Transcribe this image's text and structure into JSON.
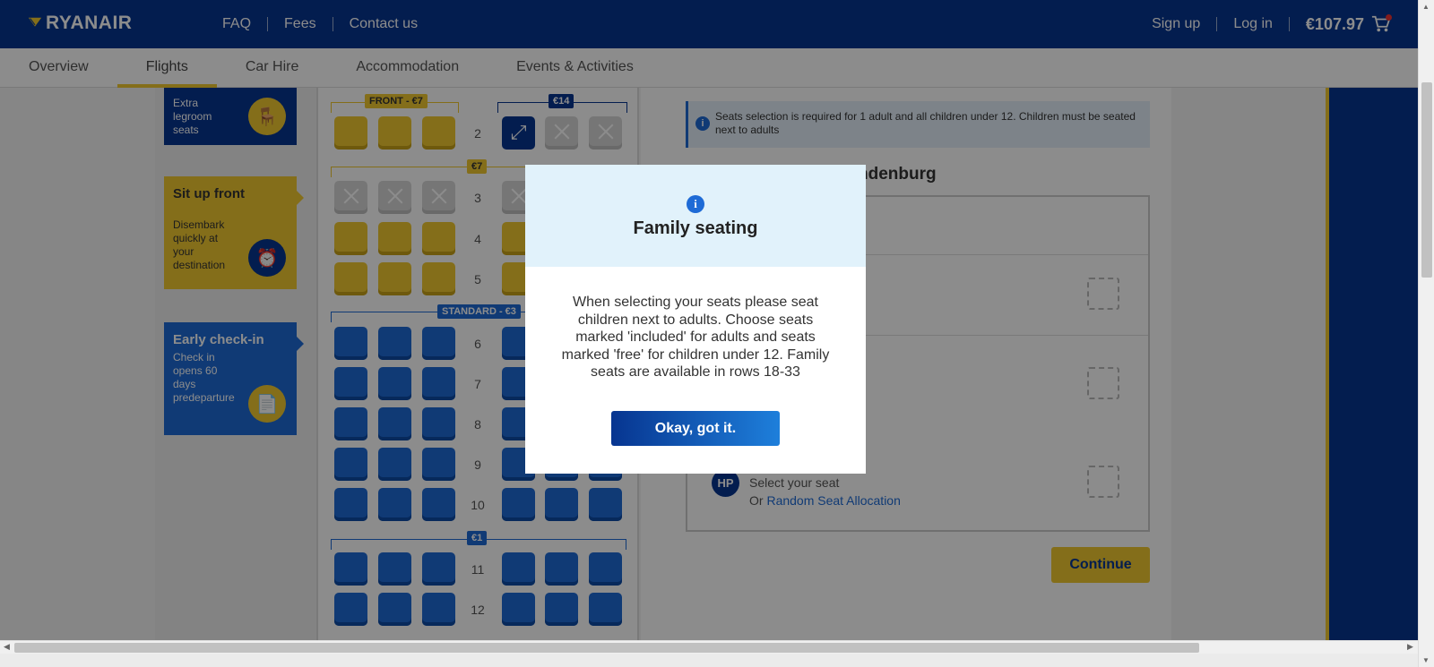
{
  "header": {
    "logo": "RYANAIR",
    "nav": [
      "FAQ",
      "Fees",
      "Contact us"
    ],
    "sign_up": "Sign up",
    "log_in": "Log in",
    "price": "€107.97"
  },
  "tabs": [
    "Overview",
    "Flights",
    "Car Hire",
    "Accommodation",
    "Events & Activities"
  ],
  "sidebar": {
    "extra_legroom": "Extra legroom seats",
    "sit_up_front": {
      "title": "Sit up front",
      "body": "Disembark quickly at your destination"
    },
    "early_checkin": {
      "title": "Early check-in",
      "body": "Check in opens 60 days predeparture"
    }
  },
  "seatmap": {
    "zones": {
      "front": "FRONT - €7",
      "extra": "€14",
      "mid": "€7",
      "standard": "STANDARD - €3",
      "cheap": "€1"
    },
    "rows": [
      "2",
      "3",
      "4",
      "5",
      "6",
      "7",
      "8",
      "9",
      "10",
      "11",
      "12"
    ]
  },
  "panel": {
    "info": "Seats selection is required for 1 adult and all children under 12. Children must be seated next to adults",
    "destination": "ndenburg",
    "initials": "HP",
    "select_seat": "Select your seat",
    "or": "Or",
    "random": "Random Seat Allocation",
    "continue": "Continue"
  },
  "modal": {
    "icon": "i",
    "title": "Family seating",
    "body": "When selecting your seats please seat children next to adults. Choose seats marked 'included' for adults and seats marked 'free' for children under 12. Family seats are available in rows 18-33",
    "button": "Okay, got it."
  },
  "colors": {
    "brand_blue": "#073590",
    "brand_yellow": "#f1c931",
    "accent_blue": "#1e6bd6"
  }
}
